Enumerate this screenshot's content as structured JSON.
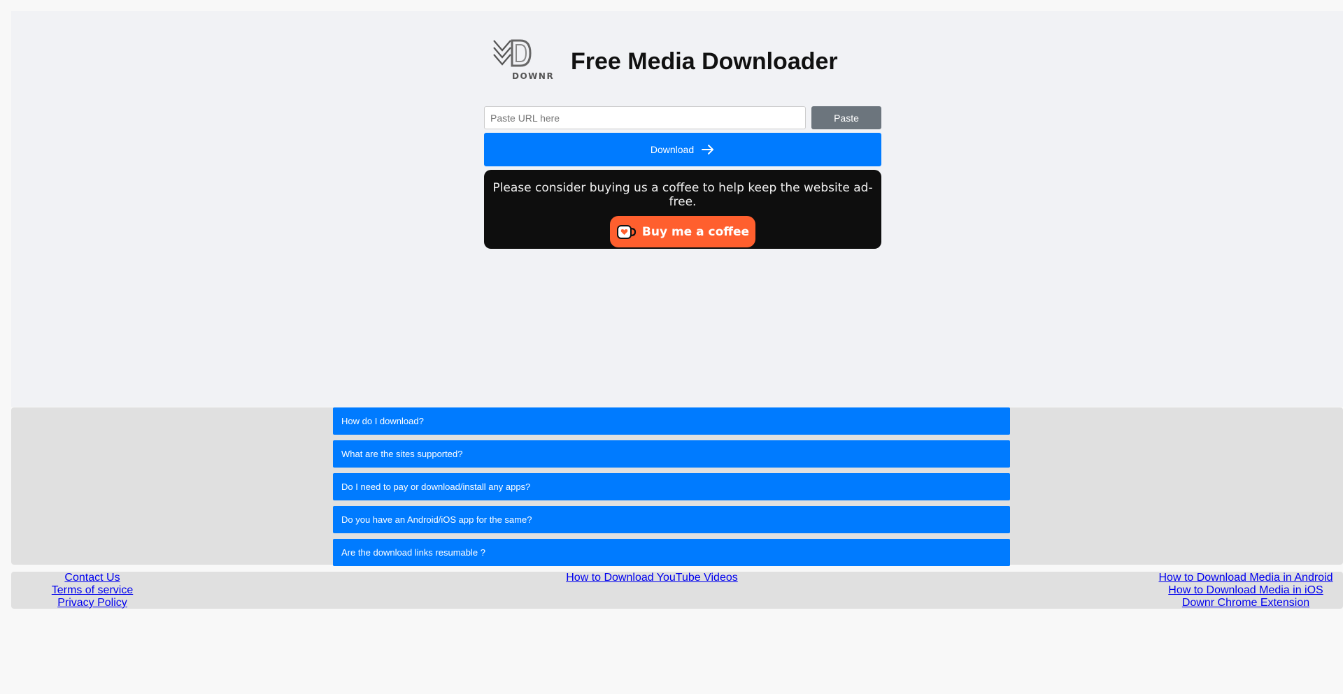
{
  "header": {
    "logo_text": "DOWNR",
    "title": "Free Media Downloader"
  },
  "url_input": {
    "placeholder": "Paste URL here",
    "value": ""
  },
  "paste_label": "Paste",
  "download_label": "Download",
  "coffee": {
    "message": "Please consider buying us a coffee to help keep the website ad-free.",
    "button_label": "Buy me a coffee"
  },
  "faq": [
    {
      "question": "How do I download?"
    },
    {
      "question": "What are the sites supported?"
    },
    {
      "question": "Do I need to pay or download/install any apps?"
    },
    {
      "question": "Do you have an Android/iOS app for the same?"
    },
    {
      "question": "Are the download links resumable ?"
    }
  ],
  "footer": {
    "left": [
      "Contact Us",
      "Terms of service",
      "Privacy Policy"
    ],
    "middle": [
      "How to Download YouTube Videos"
    ],
    "right": [
      "How to Download Media in Android",
      "How to Download Media in iOS",
      "Downr Chrome Extension"
    ]
  },
  "colors": {
    "primary": "#007bff",
    "secondary": "#6c757d",
    "coffee_bg": "#0e0e0e",
    "coffee_button": "#ff5f2e"
  }
}
